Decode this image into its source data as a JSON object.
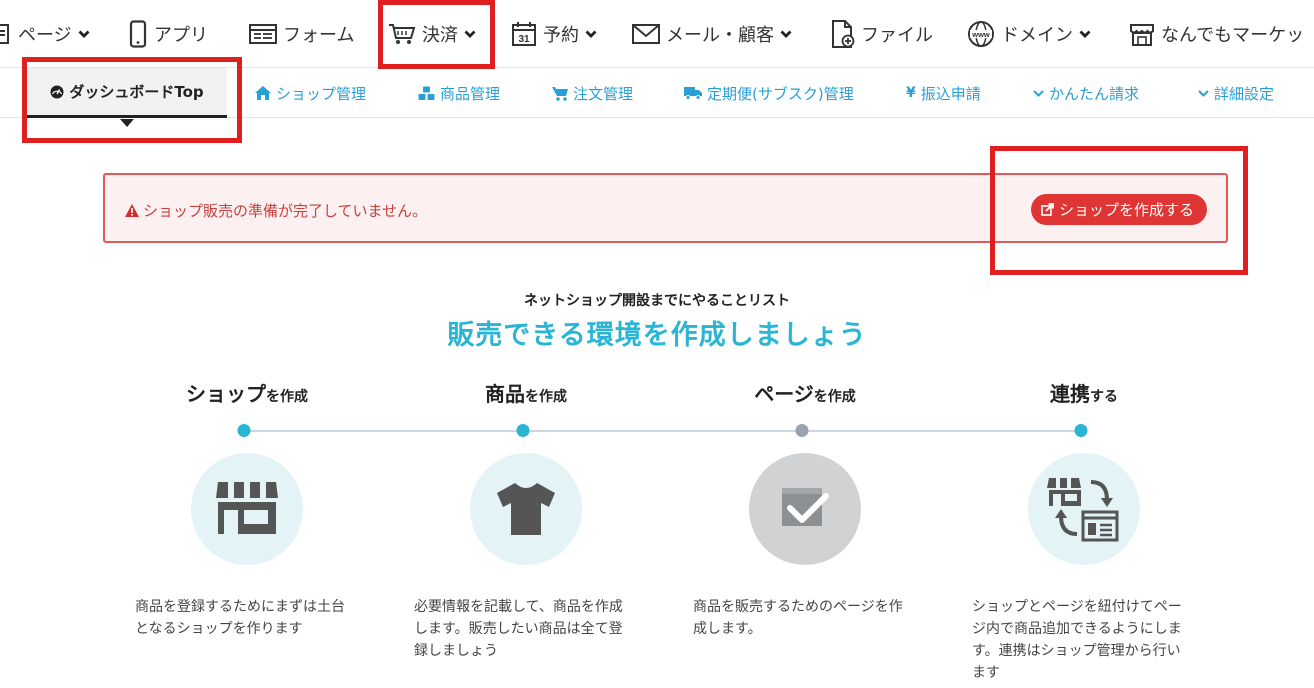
{
  "topnav": {
    "items": [
      {
        "label": "ページ",
        "icon": "page-icon",
        "has_dropdown": true
      },
      {
        "label": "アプリ",
        "icon": "smartphone-icon",
        "has_dropdown": false
      },
      {
        "label": "フォーム",
        "icon": "form-icon",
        "has_dropdown": false
      },
      {
        "label": "決済",
        "icon": "cart-icon",
        "has_dropdown": true
      },
      {
        "label": "予約",
        "icon": "calendar-icon",
        "has_dropdown": true
      },
      {
        "label": "メール・顧客",
        "icon": "mail-icon",
        "has_dropdown": true
      },
      {
        "label": "ファイル",
        "icon": "file-icon",
        "has_dropdown": false
      },
      {
        "label": "ドメイン",
        "icon": "globe-www-icon",
        "has_dropdown": true
      },
      {
        "label": "なんでもマーケッ",
        "icon": "market-icon",
        "has_dropdown": false
      }
    ]
  },
  "subnav": {
    "tabs": [
      {
        "label": "ダッシュボードTop",
        "icon": "dashboard-icon",
        "active": true
      },
      {
        "label": "ショップ管理",
        "icon": "home-icon"
      },
      {
        "label": "商品管理",
        "icon": "cubes-icon"
      },
      {
        "label": "注文管理",
        "icon": "cart-icon"
      },
      {
        "label": "定期便(サブスク)管理",
        "icon": "truck-icon"
      },
      {
        "label": "振込申請",
        "icon": "yen-icon"
      },
      {
        "label": "かんたん請求",
        "icon": "chevron-down-icon"
      },
      {
        "label": "詳細設定",
        "icon": "chevron-down-icon"
      }
    ]
  },
  "alert": {
    "message": "ショップ販売の準備が完了していません。",
    "button_label": "ショップを作成する"
  },
  "intro": {
    "subheading": "ネットショップ開設までにやることリスト",
    "heading": "販売できる環境を作成しましょう"
  },
  "steps": [
    {
      "title_main": "ショップ",
      "title_suffix": "を作成",
      "description": "商品を登録するためにまずは土台となるショップを作ります",
      "icon": "store-icon",
      "state": "active"
    },
    {
      "title_main": "商品",
      "title_suffix": "を作成",
      "description": "必要情報を記載して、商品を作成します。販売したい商品は全て登録しましょう",
      "icon": "tshirt-icon",
      "state": "active"
    },
    {
      "title_main": "ページ",
      "title_suffix": "を作成",
      "description": "商品を販売するためのページを作成します。",
      "icon": "page-check-icon",
      "state": "inactive"
    },
    {
      "title_main": "連携",
      "title_suffix": "する",
      "description": "ショップとページを紐付けてページ内で商品追加できるようにします。連携はショップ管理から行います",
      "icon": "sync-store-page-icon",
      "state": "active"
    }
  ],
  "colors": {
    "accent": "#28b6d4",
    "link": "#2a9fd6",
    "alert_bg": "#fdf0f0",
    "alert_border": "#e05a5a",
    "danger_button": "#e03535",
    "highlight_box": "#e02020",
    "inactive_dot": "#9aa3ad",
    "icon_circle": "#e3f3f6",
    "icon_circle_inactive": "#d0d2d4"
  }
}
